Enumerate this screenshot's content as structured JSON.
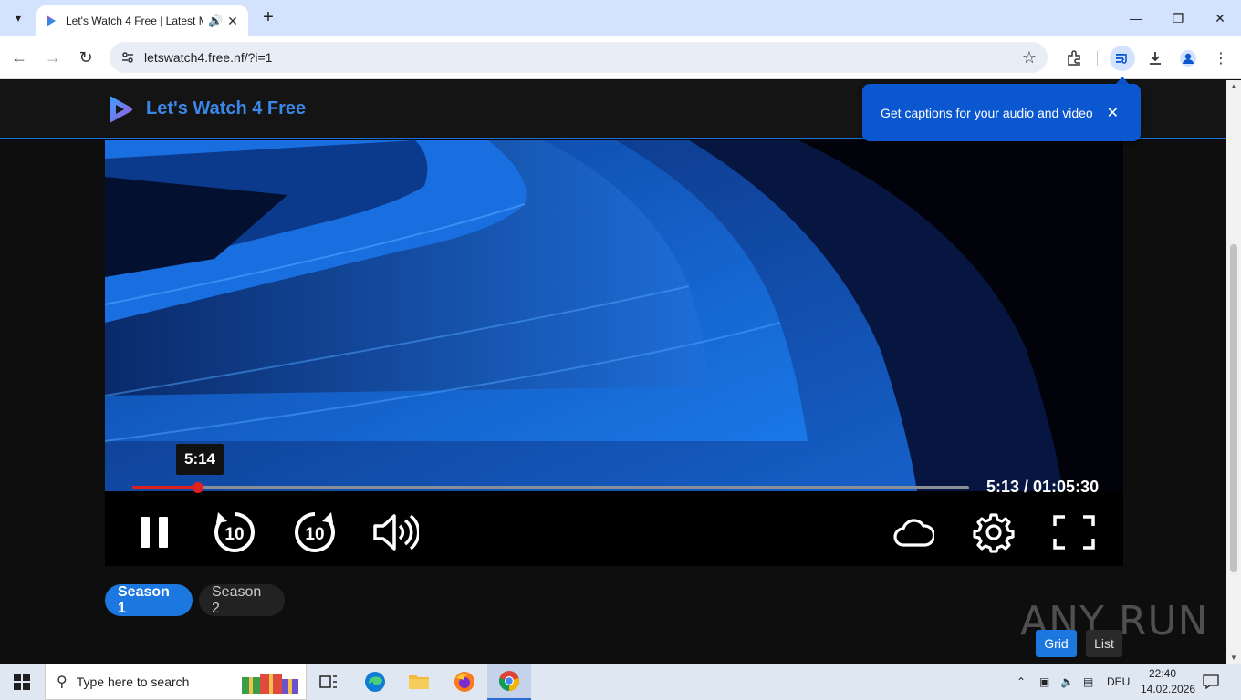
{
  "browser": {
    "tab": {
      "title": "Let's Watch 4 Free | Latest M"
    },
    "url": "letswatch4.free.nf/?i=1"
  },
  "site": {
    "name": "Let's Watch 4 Free"
  },
  "player": {
    "tooltip_time": "5:14",
    "time_display": "5:13 / 01:05:30",
    "progress_fraction": 0.078,
    "skip_seconds": "10"
  },
  "captions_popup": {
    "text": "Get captions for your audio and video"
  },
  "seasons": [
    {
      "label": "Season 1",
      "active": true
    },
    {
      "label": "Season 2",
      "active": false
    }
  ],
  "view": {
    "grid_label": "Grid",
    "list_label": "List"
  },
  "watermark": "ANY RUN",
  "taskbar": {
    "search_placeholder": "Type here to search",
    "language": "DEU",
    "time": "22:40",
    "date": "14.02.2026"
  },
  "colors": {
    "accent": "#1c78e0",
    "progress": "#e0201c",
    "popup": "#0b57d0"
  }
}
